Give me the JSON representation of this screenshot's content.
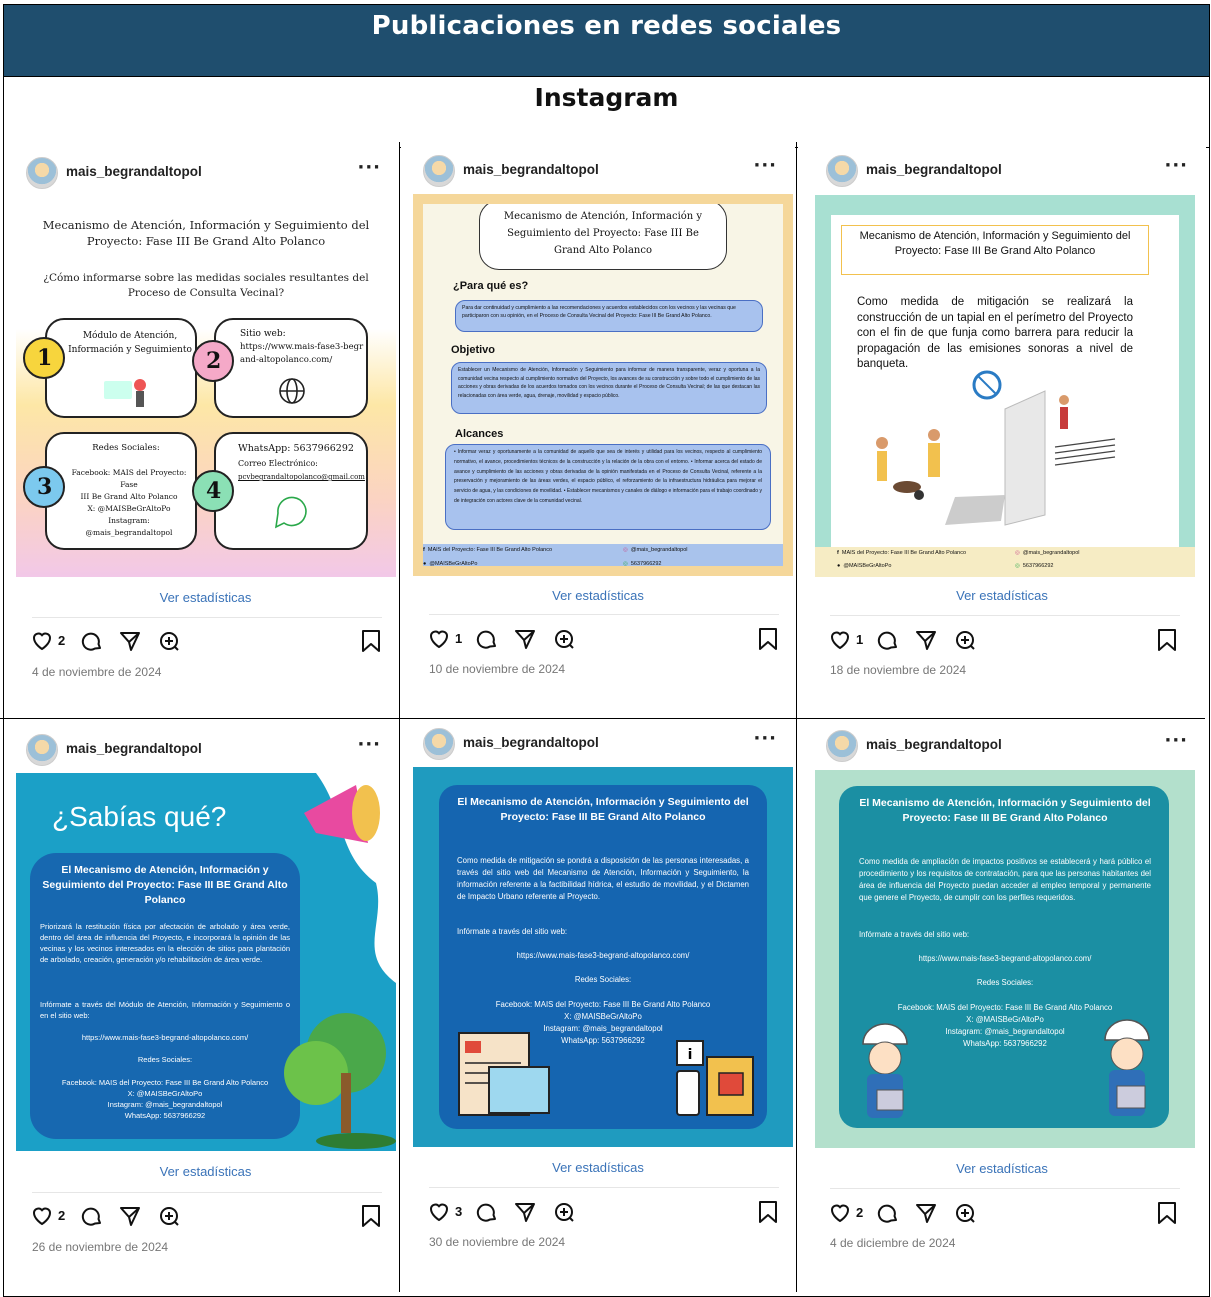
{
  "document": {
    "title": "Publicaciones en redes sociales",
    "subtitle": "Instagram"
  },
  "posts": [
    {
      "username": "mais_begrandaltopol",
      "stats_label": "Ver estadísticas",
      "likes": "2",
      "date": "4 de noviembre de 2024",
      "image": {
        "title": "Mecanismo de Atención, Información y Seguimiento del Proyecto: Fase III Be Grand Alto Polanco",
        "question": "¿Cómo informarse sobre las medidas sociales resultantes del Proceso de Consulta Vecinal?",
        "box1": "Módulo de Atención, Información y Seguimiento",
        "box2_title": "Sitio web:",
        "box2_url": "https://www.mais-fase3-begrand-altopolanco.com/",
        "box3_title": "Redes Sociales:",
        "box3_lines": [
          "Facebook: MAIS del Proyecto: Fase",
          "III Be Grand Alto Polanco",
          "X: @MAISBeGrAltoPo",
          "Instagram: @mais_begrandaltopol"
        ],
        "box4_title": "WhatsApp: 5637966292",
        "box4_sub": "Correo Electrónico:",
        "box4_email": "pcvbegrandaltopolanco@gmail.com",
        "n1": "1",
        "n2": "2",
        "n3": "3",
        "n4": "4"
      }
    },
    {
      "username": "mais_begrandaltopol",
      "stats_label": "Ver estadísticas",
      "likes": "1",
      "date": "10 de noviembre de 2024",
      "image": {
        "title": "Mecanismo de Atención, Información y Seguimiento del Proyecto: Fase III Be Grand Alto Polanco",
        "h1": "¿Para qué es?",
        "p1": "Para dar continuidad y cumplimiento a las recomendaciones y acuerdos establecidos con los vecinos y las vecinas que participaron con su opinión, en el Proceso de Consulta Vecinal del Proyecto: Fase III Be Grand Alto Polanco.",
        "h2": "Objetivo",
        "p2": "Establecer un Mecanismo de Atención, Información y Seguimiento para informar de manera transparente, veraz y oportuna a la comunidad vecina respecto al cumplimiento normativo del Proyecto, los avances de su construcción y sobre todo el cumplimiento de las acciones y obras derivadas de los acuerdos tomados con los vecinos durante el Proceso de Consulta Vecinal; de las que destacan las relacionadas con área verde, agua, drenaje, movilidad y espacio público.",
        "h3": "Alcances",
        "p3": "• Informar veraz y oportunamente a la comunidad de aquello que sea de interés y utilidad para los vecinos, respecto al cumplimiento normativo, el avance, procedimientos técnicos de la construcción y la relación de la obra con el entorno. • Informar acerca del estado de avance y cumplimiento de las acciones y obras derivadas de la opinión manifestada en el Proceso de Consulta Vecinal, referente a la preservación y mejoramiento de las áreas verdes, el espacio público, el reforzamiento de la infraestructura hidráulica para mejorar el servicio de agua, y las condiciones de movilidad. • Establecer mecanismos y canales de diálogo e información para el trabajo coordinado y de integración con actores clave de la comunidad vecinal.",
        "footer_fb": "MAIS del Proyecto: Fase III Be Grand Alto Polanco",
        "footer_x": "@MAISBeGrAltoPo",
        "footer_ig": "@mais_begrandaltopol",
        "footer_wa": "5637966292"
      }
    },
    {
      "username": "mais_begrandaltopol",
      "stats_label": "Ver estadísticas",
      "likes": "1",
      "date": "18 de noviembre de 2024",
      "image": {
        "title": "Mecanismo de Atención, Información y Seguimiento del Proyecto: Fase III Be Grand Alto Polanco",
        "body": "Como medida de mitigación se realizará la construcción de un tapial en el perímetro del Proyecto con el fin de que funja como barrera para reducir la propagación de las emisiones sonoras a nivel de banqueta.",
        "footer_fb": "MAIS del Proyecto: Fase III Be Grand Alto Polanco",
        "footer_x": "@MAISBeGrAltoPo",
        "footer_ig": "@mais_begrandaltopol",
        "footer_wa": "5637966292"
      }
    },
    {
      "username": "mais_begrandaltopol",
      "stats_label": "Ver estadísticas",
      "likes": "2",
      "date": "26 de noviembre de 2024",
      "image": {
        "headline": "¿Sabías qué?",
        "title": "El Mecanismo de Atención, Información y Seguimiento del Proyecto: Fase III BE Grand Alto Polanco",
        "body": "Priorizará la restitución física por afectación de arbolado y área verde, dentro del área de influencia del Proyecto, e incorporará la opinión de las vecinas y los vecinos interesados en la elección de sitios para plantación de arbolado, creación, generación y/o rehabilitación de área verde.",
        "info": "Infórmate a través del Módulo de Atención, Información y Seguimiento o en el sitio web:",
        "url": "https://www.mais-fase3-begrand-altopolanco.com/",
        "redes": "Redes Sociales:",
        "social": [
          "Facebook: MAIS del Proyecto: Fase III Be Grand Alto Polanco",
          "X: @MAISBeGrAltoPo",
          "Instagram: @mais_begrandaltopol",
          "WhatsApp: 5637966292"
        ]
      }
    },
    {
      "username": "mais_begrandaltopol",
      "stats_label": "Ver estadísticas",
      "likes": "3",
      "date": "30 de noviembre de 2024",
      "image": {
        "title": "El Mecanismo de Atención, Información y Seguimiento del Proyecto: Fase III BE Grand Alto Polanco",
        "body": "Como medida de mitigación se pondrá a disposición de las personas interesadas, a través del sitio web del Mecanismo de Atención, Información y Seguimiento, la información referente a la factibilidad hídrica, el estudio de movilidad, y el Dictamen de Impacto Urbano referente al Proyecto.",
        "info": "Infórmate a través del sitio web:",
        "url": "https://www.mais-fase3-begrand-altopolanco.com/",
        "redes": "Redes Sociales:",
        "social": [
          "Facebook: MAIS del Proyecto: Fase III Be Grand Alto Polanco",
          "X: @MAISBeGrAltoPo",
          "Instagram: @mais_begrandaltopol",
          "WhatsApp: 5637966292"
        ]
      }
    },
    {
      "username": "mais_begrandaltopol",
      "stats_label": "Ver estadísticas",
      "likes": "2",
      "date": "4 de diciembre de 2024",
      "image": {
        "title": "El Mecanismo de Atención, Información y Seguimiento del Proyecto: Fase III BE Grand Alto Polanco",
        "body": "Como medida de ampliación de impactos positivos se establecerá y hará público el procedimiento y los requisitos de contratación, para que las personas habitantes del área de influencia del Proyecto puedan acceder al empleo temporal y permanente que genere el Proyecto, de cumplir con los perfiles requeridos.",
        "info": "Infórmate a través del sitio web:",
        "url": "https://www.mais-fase3-begrand-altopolanco.com/",
        "redes": "Redes Sociales:",
        "social": [
          "Facebook: MAIS del Proyecto: Fase III Be Grand Alto Polanco",
          "X: @MAISBeGrAltoPo",
          "Instagram: @mais_begrandaltopol",
          "WhatsApp: 5637966292"
        ]
      }
    }
  ],
  "colors": {
    "header_band": "#1f4e6e",
    "stats_link": "#3a73b8",
    "teal": "#0f8fa8",
    "navy": "#1565b0"
  },
  "icons": [
    "heart-icon",
    "comment-icon",
    "share-icon",
    "remix-icon",
    "bookmark-icon",
    "more-icon"
  ]
}
